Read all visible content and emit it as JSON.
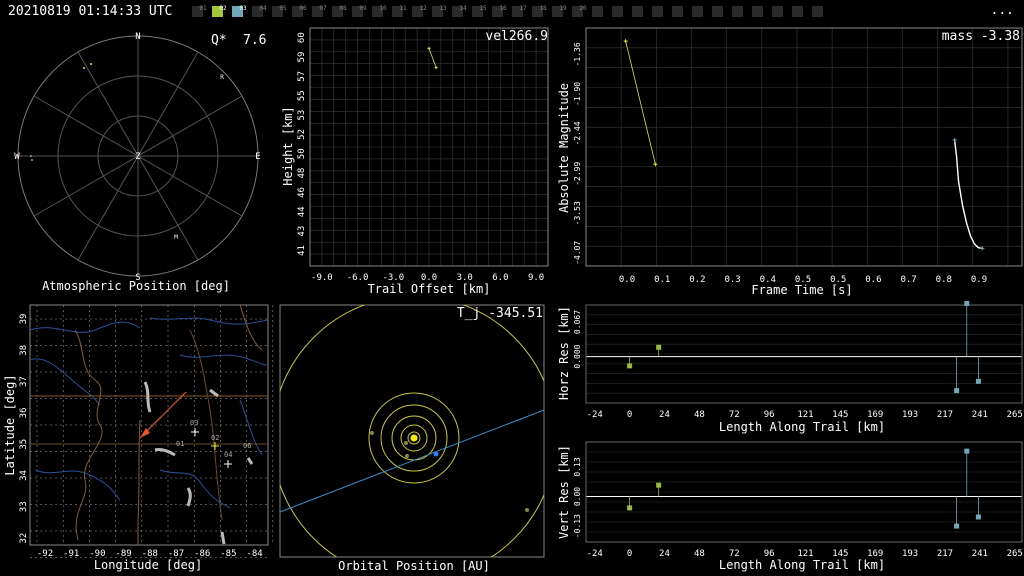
{
  "header": {
    "timestamp": "20210819 01:14:33 UTC",
    "more": "..."
  },
  "stations": {
    "labels": [
      "01",
      "02",
      "03",
      "04",
      "05",
      "06",
      "07",
      "08",
      "09",
      "10",
      "11",
      "12",
      "13",
      "14",
      "15",
      "16",
      "17",
      "18",
      "19",
      "20"
    ],
    "active": {
      "02": "#a4c639",
      "03": "#6fa8b8"
    }
  },
  "colors": {
    "trail": "#e6e632",
    "fit": "#ffffff",
    "station2": "#9ab940",
    "station3": "#6fa8b8",
    "grid": "#3a3a3a",
    "orbit": "#c8c832",
    "earth_orbit_path": "#3a8fd0"
  },
  "atmos": {
    "title": "Atmospheric Position [deg]",
    "q_label": "Q*",
    "q_value": "7.6",
    "dirs": {
      "n": "N",
      "s": "S",
      "e": "E",
      "w": "W",
      "z": "Z"
    },
    "markers": [
      {
        "label": "R"
      },
      {
        "label": "M"
      }
    ]
  },
  "height": {
    "label": "vel266.9",
    "xlabel": "Trail Offset [km]",
    "ylabel": "Height [km]",
    "xticks": [
      "-9.0",
      "-6.0",
      "-3.0",
      "0.0",
      "3.0",
      "6.0",
      "9.0"
    ],
    "yticks": [
      "41",
      "43",
      "44",
      "46",
      "48",
      "50",
      "52",
      "53",
      "55",
      "57",
      "59",
      "60"
    ]
  },
  "magnitude": {
    "label": "mass -3.38",
    "xlabel": "Frame Time [s]",
    "ylabel": "Absolute Magnitude",
    "xticks": [
      "0.0",
      "0.1",
      "0.2",
      "0.3",
      "0.4",
      "0.5",
      "0.5",
      "0.6",
      "0.7",
      "0.8",
      "0.9"
    ],
    "yticks": [
      "-4.07",
      "-3.53",
      "-2.99",
      "-2.44",
      "-1.90",
      "-1.36"
    ]
  },
  "map": {
    "xlabel": "Longitude [deg]",
    "ylabel": "Latitude [deg]",
    "xticks": [
      "-92",
      "-91",
      "-90",
      "-89",
      "-88",
      "-87",
      "-86",
      "-85",
      "-84"
    ],
    "yticks": [
      "39",
      "38",
      "37",
      "36",
      "35",
      "34",
      "33",
      "32"
    ],
    "station_labels": [
      "01",
      "02",
      "03",
      "04",
      "06"
    ]
  },
  "orbit": {
    "label": "T_j -345.51",
    "xlabel": "Orbital Position [AU]"
  },
  "horz": {
    "ylabel": "Horz Res [km]",
    "xlabel": "Length Along Trail [km]",
    "xticks": [
      "-24",
      "0",
      "24",
      "48",
      "72",
      "96",
      "121",
      "145",
      "169",
      "193",
      "217",
      "241",
      "265"
    ],
    "yticks": [
      "0.067",
      "0.000"
    ]
  },
  "vert": {
    "ylabel": "Vert Res [km]",
    "xlabel": "Length Along Trail [km]",
    "xticks": [
      "-24",
      "0",
      "24",
      "48",
      "72",
      "96",
      "121",
      "145",
      "169",
      "193",
      "217",
      "241",
      "265"
    ],
    "yticks": [
      "0.13",
      "0.00",
      "-0.13"
    ]
  },
  "chart_data": [
    {
      "type": "scatter",
      "panel": "height",
      "xlim": [
        -10,
        10
      ],
      "ylim": [
        40,
        61
      ],
      "series": [
        {
          "x": [
            0.0,
            0.6
          ],
          "y": [
            59.2,
            57.5
          ]
        }
      ]
    },
    {
      "type": "line",
      "panel": "magnitude",
      "xlim": [
        -0.1,
        1.0
      ],
      "ylim": [
        -4.25,
        -1.0
      ],
      "series": [
        {
          "x": [
            0.0,
            0.075
          ],
          "y": [
            -1.18,
            -2.86
          ]
        },
        {
          "x": [
            0.83,
            0.835,
            0.84,
            0.85,
            0.86,
            0.87,
            0.88,
            0.89,
            0.9
          ],
          "y": [
            -2.53,
            -2.76,
            -3.1,
            -3.42,
            -3.66,
            -3.84,
            -3.95,
            -4.0,
            -4.01
          ]
        }
      ]
    },
    {
      "type": "scatter",
      "panel": "horz_residual",
      "xlim": [
        -30,
        270
      ],
      "ylim": [
        -0.09,
        0.1
      ],
      "series": [
        {
          "x": [
            0,
            20
          ],
          "y": [
            -0.018,
            0.018
          ]
        },
        {
          "x": [
            225,
            232,
            240
          ],
          "y": [
            -0.066,
            0.103,
            -0.048
          ]
        }
      ]
    },
    {
      "type": "scatter",
      "panel": "vert_residual",
      "xlim": [
        -30,
        270
      ],
      "ylim": [
        -0.2,
        0.24
      ],
      "series": [
        {
          "x": [
            0,
            20
          ],
          "y": [
            -0.05,
            0.05
          ]
        },
        {
          "x": [
            225,
            232,
            240
          ],
          "y": [
            -0.13,
            0.2,
            -0.09
          ]
        }
      ]
    }
  ]
}
